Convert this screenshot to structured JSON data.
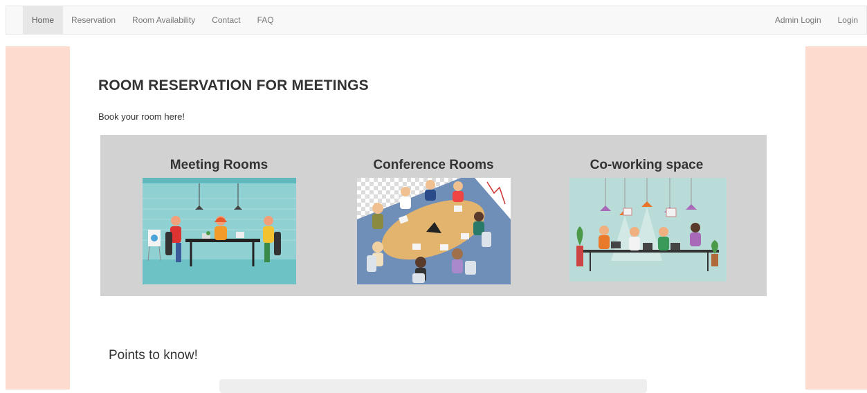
{
  "nav": {
    "left": [
      "Home",
      "Reservation",
      "Room Availability",
      "Contact",
      "FAQ"
    ],
    "right": [
      "Admin Login",
      "Login"
    ],
    "active": "Home"
  },
  "main": {
    "title": "ROOM RESERVATION FOR MEETINGS",
    "subtitle": "Book your room here!",
    "rooms": [
      {
        "title": "Meeting Rooms",
        "image": "meeting-room-illustration"
      },
      {
        "title": "Conference Rooms",
        "image": "conference-room-illustration"
      },
      {
        "title": "Co-working space",
        "image": "coworking-space-illustration"
      }
    ],
    "points_heading": "Points to know!"
  },
  "colors": {
    "side_panel": "#fedbcf",
    "rooms_panel": "#d2d2d2",
    "navbar": "#f8f8f8"
  }
}
